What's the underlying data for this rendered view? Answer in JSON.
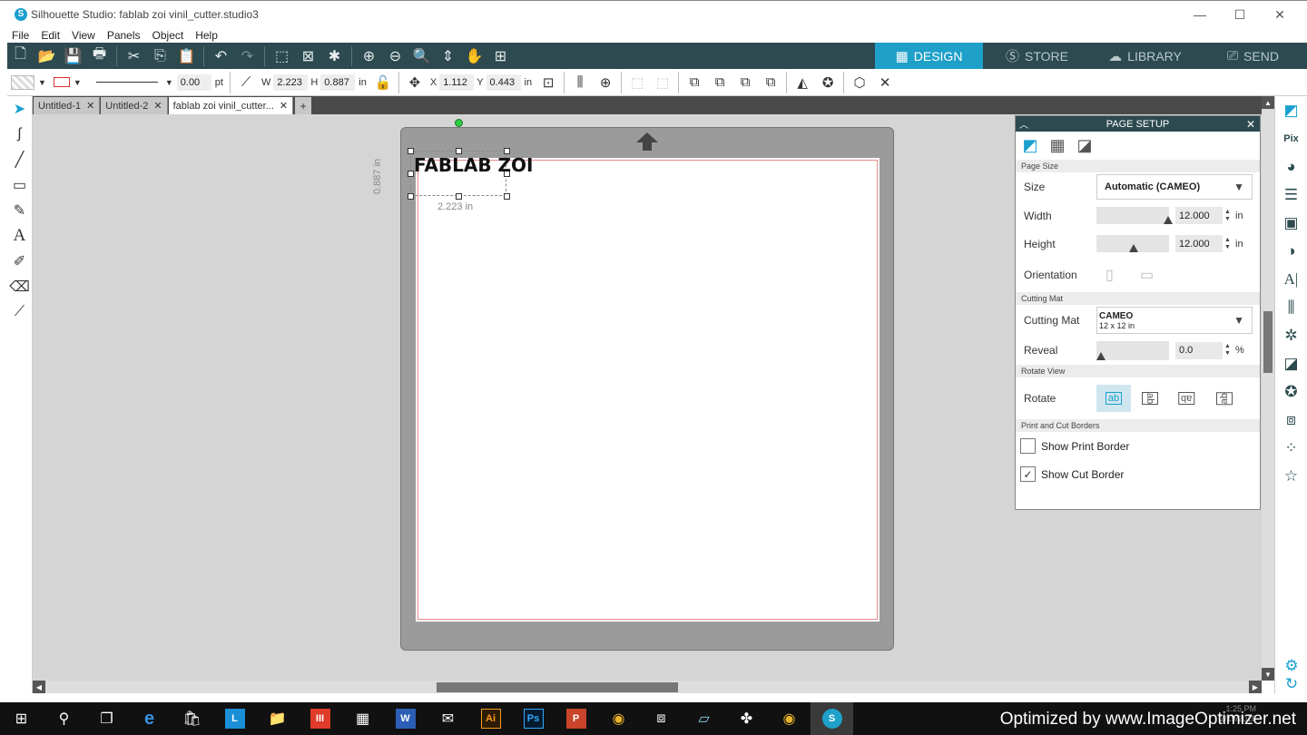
{
  "window": {
    "title": "Silhouette Studio: fablab zoi vinil_cutter.studio3",
    "app_icon": "S",
    "minimize": "—",
    "maximize": "☐",
    "close": "✕"
  },
  "menu": [
    "File",
    "Edit",
    "View",
    "Panels",
    "Object",
    "Help"
  ],
  "nav_tabs": [
    {
      "label": "DESIGN",
      "icon": "grid-icon",
      "active": true
    },
    {
      "label": "STORE",
      "icon": "silhouette-s-icon",
      "active": false
    },
    {
      "label": "LIBRARY",
      "icon": "cloud-icon",
      "active": false
    },
    {
      "label": "SEND",
      "icon": "cutter-icon",
      "active": false
    }
  ],
  "toolbar2": {
    "line_width": "0.00",
    "line_unit": "pt",
    "w_label": "W",
    "w_value": "2.223",
    "h_label": "H",
    "h_value": "0.887",
    "size_unit": "in",
    "x_label": "X",
    "x_value": "1.112",
    "y_label": "Y",
    "y_value": "0.443",
    "pos_unit": "in"
  },
  "doc_tabs": [
    {
      "label": "Untitled-1",
      "active": false
    },
    {
      "label": "Untitled-2",
      "active": false
    },
    {
      "label": "fablab zoi vinil_cutter...",
      "active": true
    }
  ],
  "add_tab": "+",
  "canvas": {
    "logo_text": "FABLAB ZOI",
    "dim_width": "2.223 in",
    "dim_height": "0.887 in"
  },
  "page_setup": {
    "title": "PAGE SETUP",
    "sections": {
      "page_size": "Page Size",
      "cutting_mat": "Cutting Mat",
      "rotate_view": "Rotate View",
      "print_cut": "Print and Cut Borders"
    },
    "size_label": "Size",
    "size_value": "Automatic (CAMEO)",
    "width_label": "Width",
    "width_value": "12.000",
    "height_label": "Height",
    "height_value": "12.000",
    "unit_in": "in",
    "orientation_label": "Orientation",
    "cutting_mat_label": "Cutting Mat",
    "cutting_mat_value": "CAMEO",
    "cutting_mat_sub": "12 x 12 in",
    "reveal_label": "Reveal",
    "reveal_value": "0.0",
    "reveal_unit": "%",
    "rotate_label": "Rotate",
    "show_print_border": "Show Print Border",
    "show_print_border_checked": false,
    "show_cut_border": "Show Cut Border",
    "show_cut_border_checked": true
  },
  "taskbar": {
    "watermark": "Optimized by www.ImageOptimizer.net",
    "time": "1:25 PM",
    "date": "2/19/2018"
  },
  "colors": {
    "accent": "#1ea0c9",
    "toolbar_dark": "#2c4a4f",
    "mat": "#9b9b9b",
    "cut_border": "#e88a8a"
  }
}
